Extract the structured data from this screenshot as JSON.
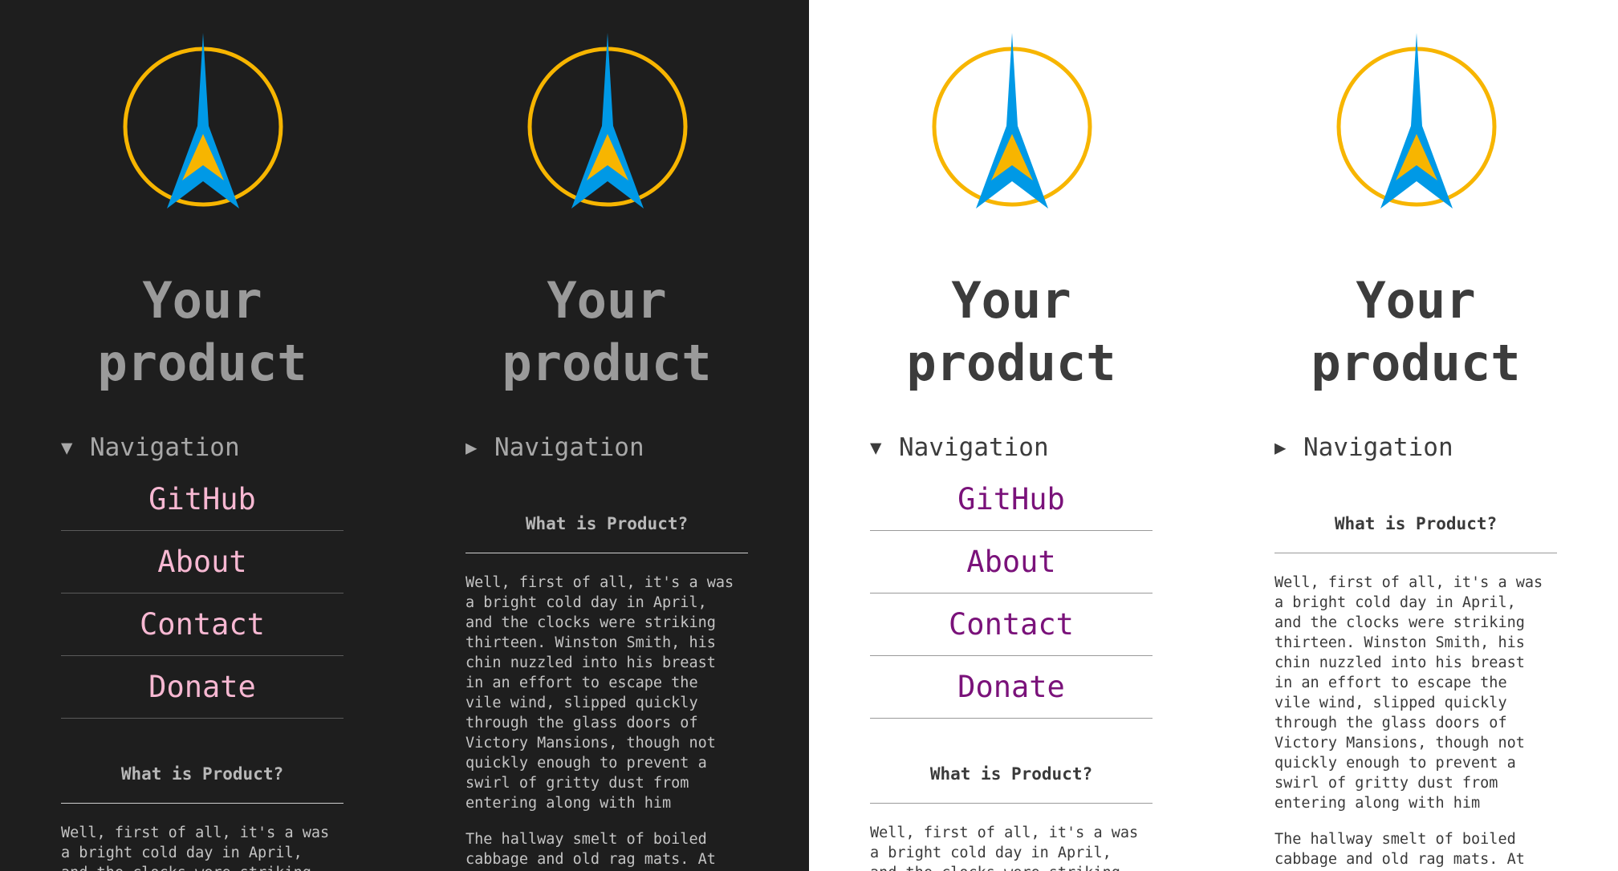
{
  "brand_colors": {
    "ring": "#f7b500",
    "tower": "#0099e6",
    "tower_fill": "#f7b500"
  },
  "panels": [
    {
      "theme": "dark",
      "title_line1": "Your",
      "title_line2": "product",
      "nav_marker": "▼",
      "nav_label": "Navigation",
      "nav_items": [
        "GitHub",
        "About",
        "Contact",
        "Donate"
      ],
      "section_heading": "What is Product?",
      "paragraph1": "Well, first of all, it's a was\na bright cold day in April,\nand the clocks were striking",
      "paragraph2": ""
    },
    {
      "theme": "dark",
      "title_line1": "Your",
      "title_line2": "product",
      "nav_marker": "▶",
      "nav_label": "Navigation",
      "nav_items": [],
      "section_heading": "What is Product?",
      "paragraph1": "Well, first of all, it's a was\na bright cold day in April,\nand the clocks were striking\nthirteen. Winston Smith, his\nchin nuzzled into his breast\nin an effort to escape the\nvile wind, slipped quickly\nthrough the glass doors of\nVictory Mansions, though not\nquickly enough to prevent a\nswirl of gritty dust from\nentering along with him",
      "paragraph2": "The hallway smelt of boiled\ncabbage and old rag mats. At"
    },
    {
      "theme": "light",
      "title_line1": "Your",
      "title_line2": "product",
      "nav_marker": "▼",
      "nav_label": "Navigation",
      "nav_items": [
        "GitHub",
        "About",
        "Contact",
        "Donate"
      ],
      "section_heading": "What is Product?",
      "paragraph1": "Well, first of all, it's a was\na bright cold day in April,\nand the clocks were striking",
      "paragraph2": ""
    },
    {
      "theme": "light",
      "title_line1": "Your",
      "title_line2": "product",
      "nav_marker": "▶",
      "nav_label": "Navigation",
      "nav_items": [],
      "section_heading": "What is Product?",
      "paragraph1": "Well, first of all, it's a was\na bright cold day in April,\nand the clocks were striking\nthirteen. Winston Smith, his\nchin nuzzled into his breast\nin an effort to escape the\nvile wind, slipped quickly\nthrough the glass doors of\nVictory Mansions, though not\nquickly enough to prevent a\nswirl of gritty dust from\nentering along with him",
      "paragraph2": "The hallway smelt of boiled\ncabbage and old rag mats. At"
    }
  ]
}
